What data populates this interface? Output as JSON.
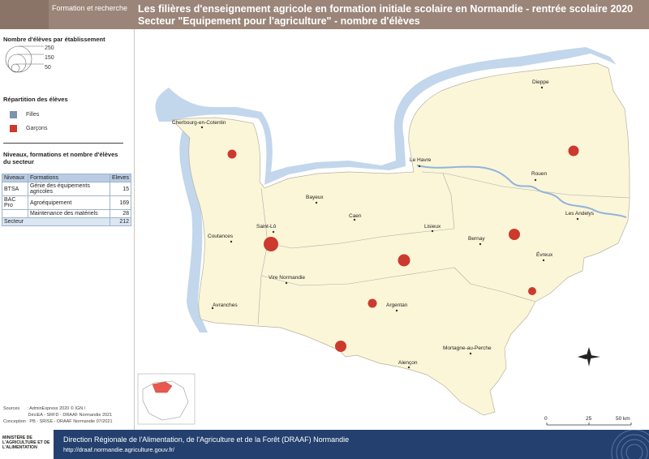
{
  "header": {
    "tag": "Formation et recherche",
    "title_line1": "Les filières d'enseignement agricole en formation initiale scolaire en Normandie - rentrée scolaire 2020",
    "title_line2": "Secteur \"Equipement pour l'agriculture\" - nombre d'élèves"
  },
  "legend": {
    "size_heading": "Nombre d'élèves par établissement",
    "size_values": [
      "250",
      "150",
      "50"
    ],
    "split_heading": "Répartition des élèves",
    "split_items": [
      {
        "label": "Filles",
        "color": "#7d93ad"
      },
      {
        "label": "Garçons",
        "color": "#cc3a2e"
      }
    ],
    "table_heading": "Niveaux, formations et nombre d'élèves du secteur",
    "table": {
      "headers": [
        "Niveaux",
        "Formations",
        "Eleves"
      ],
      "rows": [
        {
          "level": "BTSA",
          "formation": "Génie des équipements agricoles",
          "count": "15"
        },
        {
          "level": "BAC Pro",
          "formation": "Agroéquipement",
          "count": "169"
        },
        {
          "level": "",
          "formation": "Maintenance des matériels",
          "count": "28"
        }
      ],
      "total": {
        "label": "Secteur",
        "count": "212"
      }
    }
  },
  "sources": {
    "line1": "Sources      : AdminExpress 2020 © IGN /",
    "line2": "                    DéciEA - SRFD - DRAAF Normandie 2021",
    "line3": "Conception : PB - SRISE - DRAAF Normandie 07/2021"
  },
  "map": {
    "cities": [
      "Dieppe",
      "Cherbourg-en-Cotentin",
      "Le Havre",
      "Rouen",
      "Bayeux",
      "Caen",
      "Les Andelys",
      "Saint-Lô",
      "Lisieux",
      "Coutances",
      "Bernay",
      "Évreux",
      "Vire Normandie",
      "Argentan",
      "Avranches",
      "Mortagne-au-Perche",
      "Alençon"
    ],
    "scale_labels": [
      "0",
      "25",
      "50 km"
    ],
    "colors": {
      "land": "#fbf6d8",
      "coast": "#8fb4dd",
      "border": "#999999",
      "symbol": "#cc3a2e"
    }
  },
  "footer": {
    "ministry": "MINISTÈRE DE L'AGRICULTURE ET DE L'ALIMENTATION",
    "line1": "Direction Régionale de l'Alimentation, de l'Agriculture et de la Forêt (DRAAF) Normandie",
    "line2": "http://draaf.normandie.agriculture.gouv.fr/"
  }
}
